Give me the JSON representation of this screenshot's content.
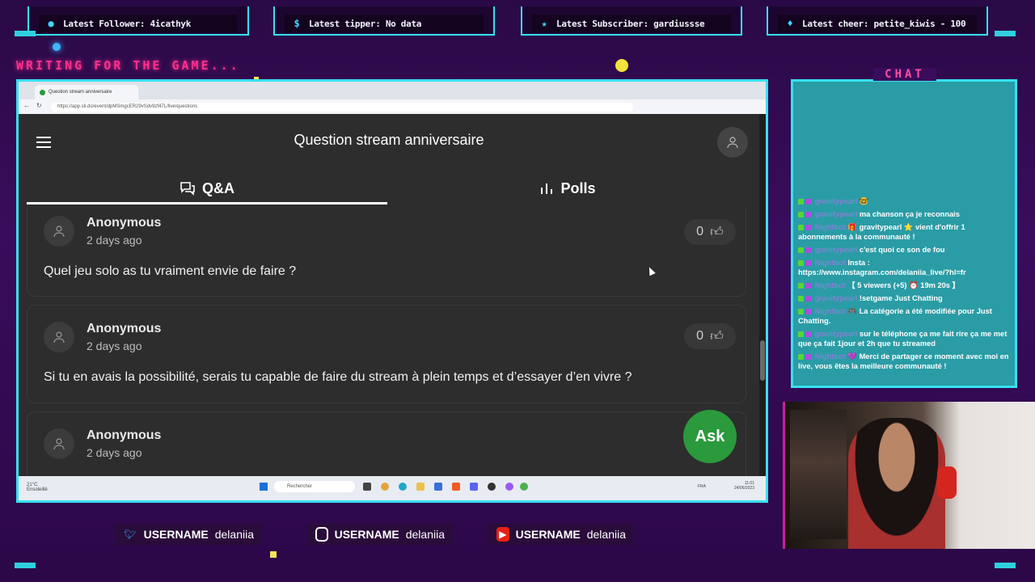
{
  "alerts": [
    {
      "icon": "user-icon",
      "label": "Latest Follower: 4icathyk"
    },
    {
      "icon": "dollar-icon",
      "label": "Latest tipper: No data"
    },
    {
      "icon": "star-icon",
      "label": "Latest Subscriber: gardiussse"
    },
    {
      "icon": "diamond-icon",
      "label": "Latest cheer: petite_kiwis - 100"
    }
  ],
  "status_text": "WRITING FOR THE GAME...",
  "browser": {
    "tab_title": "Question stream anniversaire",
    "url": "https://app.sli.do/event/dpMSmgcER29vSdv9zf47L/live/questions"
  },
  "app": {
    "page_title": "Question stream anniversaire",
    "tabs": [
      {
        "label": "Q&A",
        "icon": "chat-bubbles-icon",
        "active": true
      },
      {
        "label": "Polls",
        "icon": "bar-chart-icon",
        "active": false
      }
    ],
    "questions": [
      {
        "author": "Anonymous",
        "time": "2 days ago",
        "text": "Quel jeu solo as tu vraiment envie de faire ?",
        "likes": "0"
      },
      {
        "author": "Anonymous",
        "time": "2 days ago",
        "text": "Si tu en avais la possibilité, serais tu capable de faire du stream à plein temps et d’essayer d’en vivre ?",
        "likes": "0"
      },
      {
        "author": "Anonymous",
        "time": "2 days ago",
        "text": "",
        "likes": ""
      }
    ],
    "ask_label": "Ask"
  },
  "taskbar": {
    "weather": "21°C Ensoleillé",
    "search_placeholder": "Rechercher",
    "lang": "FRA",
    "clock": "11:01",
    "date": "24/06/2023"
  },
  "chat": {
    "title": "CHAT",
    "messages": [
      {
        "user": "gravitypearl",
        "text": "🤓"
      },
      {
        "user": "gravitypearl",
        "text": "ma chanson ça je reconnais"
      },
      {
        "user": "Nightbot",
        "text": "🎁 gravitypearl ⭐ vient d'offrir 1 abonnements à la communauté !"
      },
      {
        "user": "gravitypearl",
        "text": "c'est quoi ce son de fou"
      },
      {
        "user": "Nightbot",
        "text": "Insta : https://www.instagram.com/delaniia_live/?hl=fr"
      },
      {
        "user": "Nightbot",
        "text": "【 5 viewers (+5) ⏰ 19m 20s 】"
      },
      {
        "user": "gravitypearl",
        "text": "!setgame Just Chatting"
      },
      {
        "user": "Nightbot",
        "text": "🎮 La catégorie a été modifiée pour Just Chatting."
      },
      {
        "user": "gravitypearl",
        "text": "sur le téléphone ça me fait rire ça me met que ça fait 1jour et 2h que tu streamed"
      },
      {
        "user": "Nightbot",
        "text": "💜 Merci de partager ce moment avec moi en live, vous êtes la meilleure communauté !"
      }
    ]
  },
  "socials": [
    {
      "icon": "twitter-icon",
      "label": "USERNAME",
      "handle": "delaniia",
      "color": "#1da1f2"
    },
    {
      "icon": "instagram-icon",
      "label": "USERNAME",
      "handle": "delaniia",
      "color": "#c13584"
    },
    {
      "icon": "youtube-icon",
      "label": "USERNAME",
      "handle": "delaniia",
      "color": "#e62117"
    }
  ]
}
